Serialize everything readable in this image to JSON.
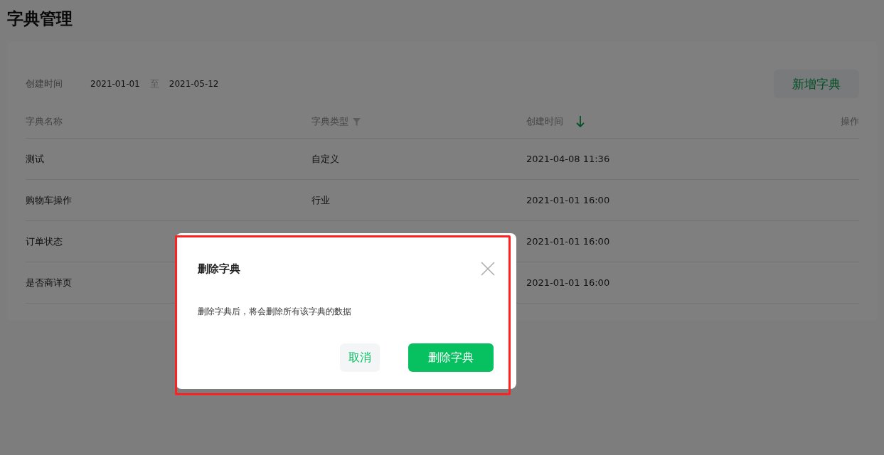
{
  "page_title": "字典管理",
  "filter": {
    "label": "创建时间",
    "start": "2021-01-01",
    "separator": "至",
    "end": "2021-05-12"
  },
  "add_button": "新增字典",
  "table": {
    "columns": [
      {
        "label": "字典名称",
        "kind": "text"
      },
      {
        "label": "字典类型",
        "kind": "filter"
      },
      {
        "label": "创建时间",
        "kind": "sort"
      },
      {
        "label": "操作",
        "kind": "actions"
      }
    ],
    "rows": [
      {
        "name": "测试",
        "type": "自定义",
        "created": "2021-04-08 11:36"
      },
      {
        "name": "购物车操作",
        "type": "行业",
        "created": "2021-01-01 16:00"
      },
      {
        "name": "订单状态",
        "created": "2021-01-01 16:00"
      },
      {
        "name": "是否商详页",
        "created": "2021-01-01 16:00"
      }
    ]
  },
  "dialog": {
    "title": "删除字典",
    "message": "删除字典后，将会删除所有该字典的数据",
    "buttons": [
      {
        "label": "取消",
        "kind": "secondary"
      },
      {
        "label": "删除字典",
        "kind": "primary"
      }
    ]
  },
  "highlight": {
    "color": "#ff2020"
  }
}
